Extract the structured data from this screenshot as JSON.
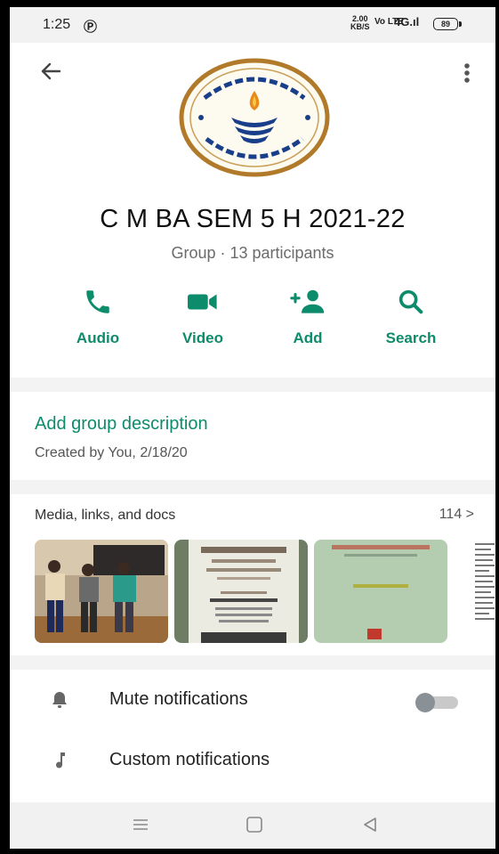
{
  "status_bar": {
    "time": "1:25",
    "app_icon": "Ⓟ",
    "speed_top": "2.00",
    "speed_bottom": "KB/S",
    "network": "Vo LTE",
    "signal": "4G.ıl",
    "battery": "89"
  },
  "header": {
    "back_icon": "arrow-left-icon",
    "menu_icon": "more-vertical-icon"
  },
  "group": {
    "title": "C M BA SEM 5 H 2021-22",
    "subtitle": "Group · 13 participants"
  },
  "actions": [
    {
      "label": "Audio",
      "icon": "phone-icon"
    },
    {
      "label": "Video",
      "icon": "video-icon"
    },
    {
      "label": "Add",
      "icon": "add-person-icon"
    },
    {
      "label": "Search",
      "icon": "search-icon"
    }
  ],
  "description": {
    "add_label": "Add group description",
    "created": "Created by You, 2/18/20"
  },
  "media": {
    "header": "Media, links, and docs",
    "count": "114 >"
  },
  "settings": [
    {
      "label": "Mute notifications",
      "icon": "bell-icon",
      "toggle": false
    },
    {
      "label": "Custom notifications",
      "icon": "music-note-icon"
    }
  ],
  "colors": {
    "accent": "#0d8c6c",
    "text": "#111111",
    "muted": "#6b6b6b",
    "separator": "#f3f3f3"
  }
}
